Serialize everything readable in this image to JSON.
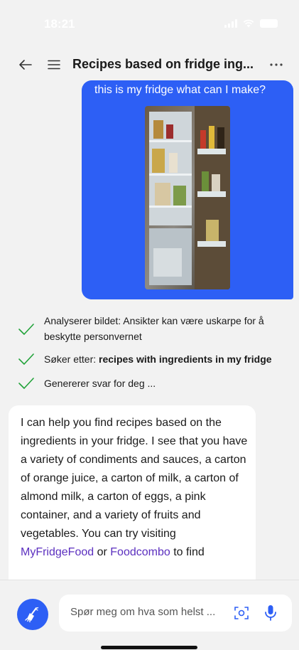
{
  "status_bar": {
    "time": "18:21"
  },
  "header": {
    "title": "Recipes based on fridge ing..."
  },
  "user_message": {
    "text": "this is my fridge what can I make?"
  },
  "steps": [
    {
      "text": "Analyserer bildet: Ansikter kan være uskarpe for å beskytte personvernet"
    },
    {
      "prefix": "Søker etter: ",
      "bold": "recipes with ingredients in my fridge"
    },
    {
      "text": "Genererer svar for deg ..."
    }
  ],
  "assistant_message": {
    "text": "I can help you find recipes based on the ingredients in your fridge. I see that you have a variety of condiments and sauces, a carton of orange juice, a carton of milk, a carton of almond milk, a carton of eggs, a pink container, and a variety of fruits and vegetables. You can try visiting ",
    "link1": "MyFridgeFood",
    "middle": " or ",
    "link2": "Foodcombo",
    "tail": " to find"
  },
  "composer": {
    "placeholder": "Spør meg om hva som helst ..."
  },
  "colors": {
    "accent": "#2d5ff5",
    "link": "#5b2fbf",
    "check": "#22a33a"
  }
}
